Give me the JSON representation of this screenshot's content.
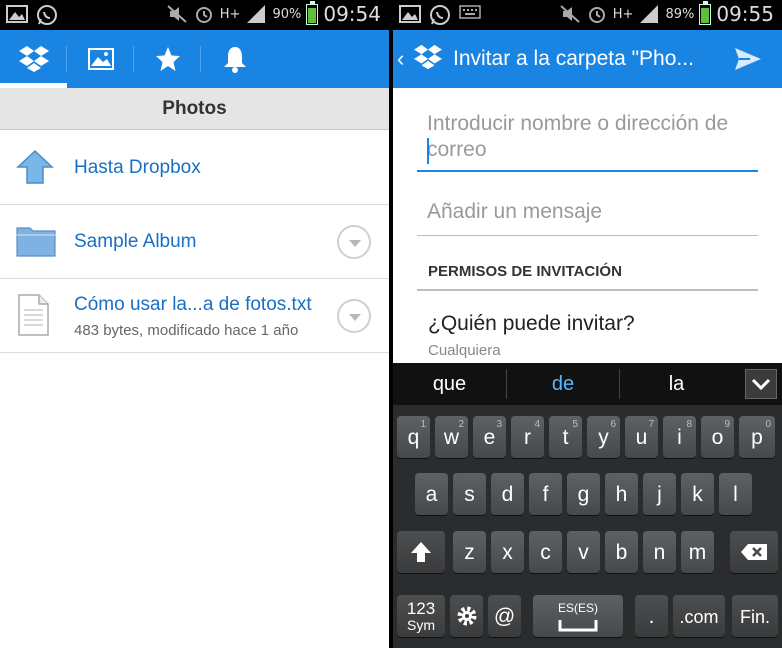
{
  "left": {
    "status": {
      "battery": "90%",
      "time": "09:54",
      "network": "H+"
    },
    "tabs": [
      {
        "name": "dropbox-icon",
        "active": true
      },
      {
        "name": "photos-icon",
        "active": false
      },
      {
        "name": "star-icon",
        "active": false
      },
      {
        "name": "bell-icon",
        "active": false
      }
    ],
    "folder_title": "Photos",
    "items": [
      {
        "title": "Hasta Dropbox",
        "subtitle": "",
        "icon": "up-arrow-icon"
      },
      {
        "title": "Sample Album",
        "subtitle": "",
        "icon": "folder-icon"
      },
      {
        "title": "Cómo usar la...a de fotos.txt",
        "subtitle": "483 bytes, modificado hace 1 año",
        "icon": "text-file-icon"
      }
    ]
  },
  "right": {
    "status": {
      "battery": "89%",
      "time": "09:55",
      "network": "H+"
    },
    "title": "Invitar a la carpeta \"Pho...",
    "email_placeholder_1": "Introducir nombre o dirección de",
    "email_placeholder_2": "correo",
    "message_placeholder": "Añadir un mensaje",
    "permissions_header": "PERMISOS DE INVITACIÓN",
    "permission_question": "¿Quién puede invitar?",
    "permission_value": "Cualquiera",
    "keyboard": {
      "suggestions": [
        "que",
        "de",
        "la"
      ],
      "row1": [
        [
          "q",
          "1"
        ],
        [
          "w",
          "2"
        ],
        [
          "e",
          "3"
        ],
        [
          "r",
          "4"
        ],
        [
          "t",
          "5"
        ],
        [
          "y",
          "6"
        ],
        [
          "u",
          "7"
        ],
        [
          "i",
          "8"
        ],
        [
          "o",
          "9"
        ],
        [
          "p",
          "0"
        ]
      ],
      "row2": [
        "a",
        "s",
        "d",
        "f",
        "g",
        "h",
        "j",
        "k",
        "l"
      ],
      "row3": [
        "z",
        "x",
        "c",
        "v",
        "b",
        "n",
        "m"
      ],
      "symbols_top": "123",
      "symbols_bottom": "Sym",
      "at": "@",
      "space_lang": "ES(ES)",
      "period": ".",
      "dotcom": ".com",
      "done": "Fin."
    }
  },
  "colors": {
    "accent": "#1a84e3",
    "link": "#1a6fc4",
    "keyboard_bg": "#2b2c2e",
    "suggestion_active": "#58b7ff"
  }
}
